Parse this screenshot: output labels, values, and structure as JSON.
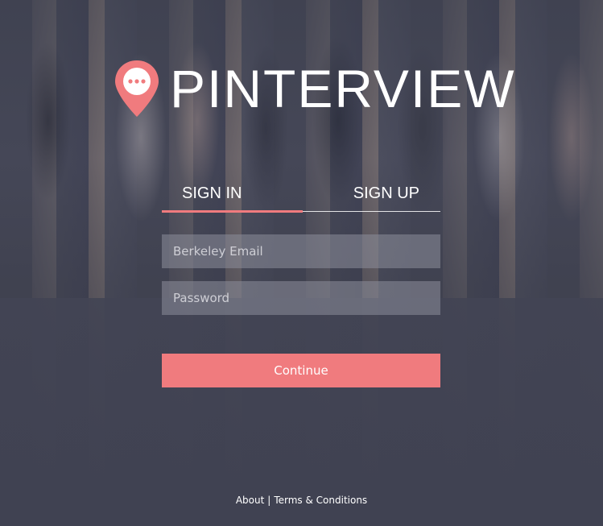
{
  "brand": {
    "name": "PINTERVIEW",
    "icon": "location-pin-chat-icon",
    "accent_color": "#f07b7e"
  },
  "tabs": {
    "sign_in": "SIGN IN",
    "sign_up": "SIGN UP",
    "active": "sign_in"
  },
  "form": {
    "email_placeholder": "Berkeley Email",
    "email_value": "",
    "password_placeholder": "Password",
    "password_value": "",
    "submit_label": "Continue"
  },
  "footer": {
    "about": "About",
    "separator": "|",
    "terms": "Terms & Conditions"
  }
}
